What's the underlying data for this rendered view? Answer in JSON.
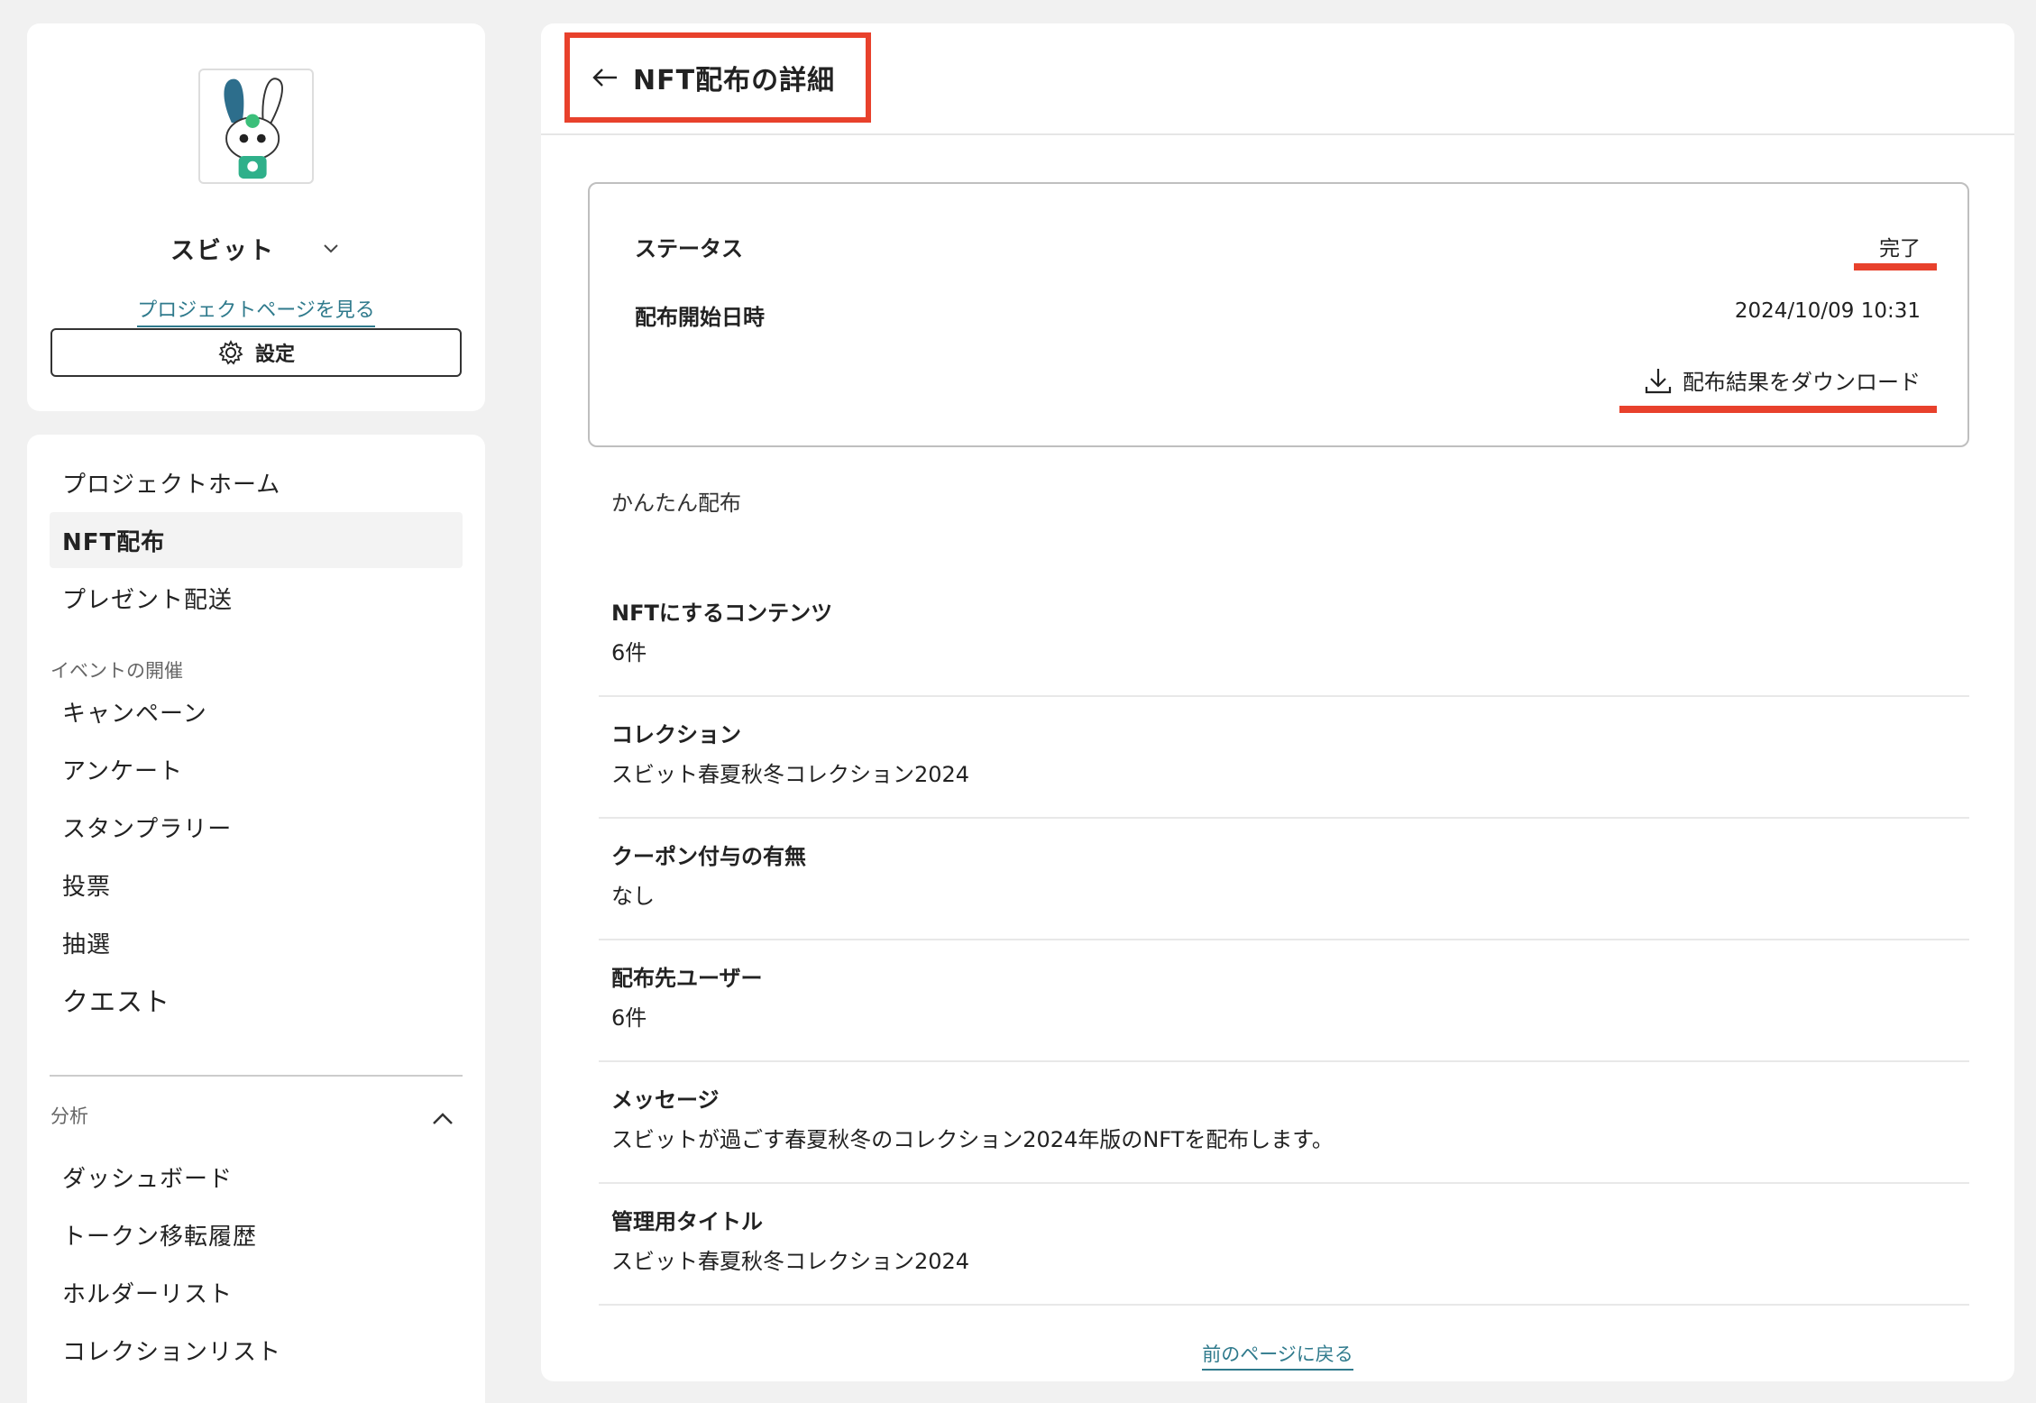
{
  "project": {
    "name": "スビット",
    "project_page_link": "プロジェクトページを見る",
    "settings_label": "設定"
  },
  "nav": {
    "items_top": [
      "プロジェクトホーム",
      "NFT配布",
      "プレゼント配送"
    ],
    "active": "NFT配布",
    "section_events": "イベントの開催",
    "items_events": [
      "キャンペーン",
      "アンケート",
      "スタンプラリー",
      "投票",
      "抽選",
      "クエスト"
    ],
    "section_analysis": "分析",
    "items_analysis": [
      "ダッシュボード",
      "トークン移転履歴",
      "ホルダーリスト",
      "コレクションリスト"
    ]
  },
  "main": {
    "title": "NFT配布の詳細",
    "status_label": "ステータス",
    "status_value": "完了",
    "start_label": "配布開始日時",
    "start_value": "2024/10/09 10:31",
    "download_label": "配布結果をダウンロード",
    "method_label": "かんたん配布",
    "fields": [
      {
        "label": "NFTにするコンテンツ",
        "value": "6件"
      },
      {
        "label": "コレクション",
        "value": "スビット春夏秋冬コレクション2024"
      },
      {
        "label": "クーポン付与の有無",
        "value": "なし"
      },
      {
        "label": "配布先ユーザー",
        "value": "6件"
      },
      {
        "label": "メッセージ",
        "value": "スビットが過ごす春夏秋冬のコレクション2024年版のNFTを配布します。"
      },
      {
        "label": "管理用タイトル",
        "value": "スビット春夏秋冬コレクション2024"
      }
    ],
    "back_link": "前のページに戻る"
  },
  "colors": {
    "accent_link": "#2f7a8c",
    "highlight_red": "#e8412c"
  }
}
